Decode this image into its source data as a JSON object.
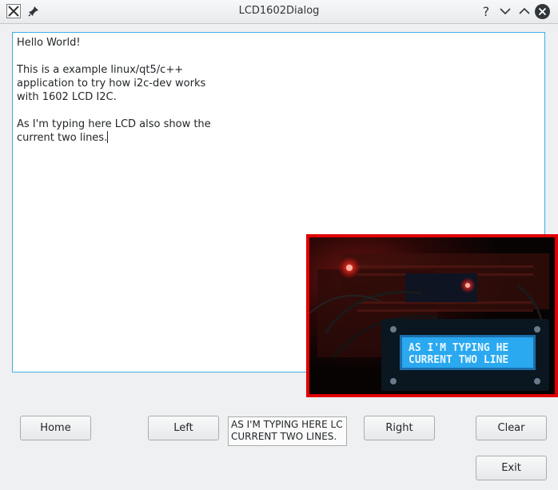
{
  "window": {
    "title": "LCD1602Dialog"
  },
  "editor": {
    "lines": [
      "Hello World!",
      "",
      "This is a example linux/qt5/c++",
      "application to try how i2c-dev works",
      "with 1602 LCD I2C.",
      "",
      "As I'm typing here LCD also show the",
      "current two lines."
    ]
  },
  "photo": {
    "lcd_line_1": "AS I'M TYPING HE",
    "lcd_line_2": "CURRENT TWO LINE"
  },
  "lcd_preview": {
    "line_1": "AS I'M TYPING HERE LC",
    "line_2": "CURRENT TWO LINES."
  },
  "buttons": {
    "home": "Home",
    "left": "Left",
    "right": "Right",
    "clear": "Clear",
    "exit": "Exit"
  },
  "icons": {
    "app": "x11-app-icon",
    "pin": "pin-icon",
    "help": "help-icon",
    "minimize": "minimize-icon",
    "maximize": "maximize-icon",
    "close": "close-icon"
  },
  "colors": {
    "focus_border": "#3daee9",
    "photo_border": "#e00000",
    "lcd_background": "#2aa8f0"
  }
}
